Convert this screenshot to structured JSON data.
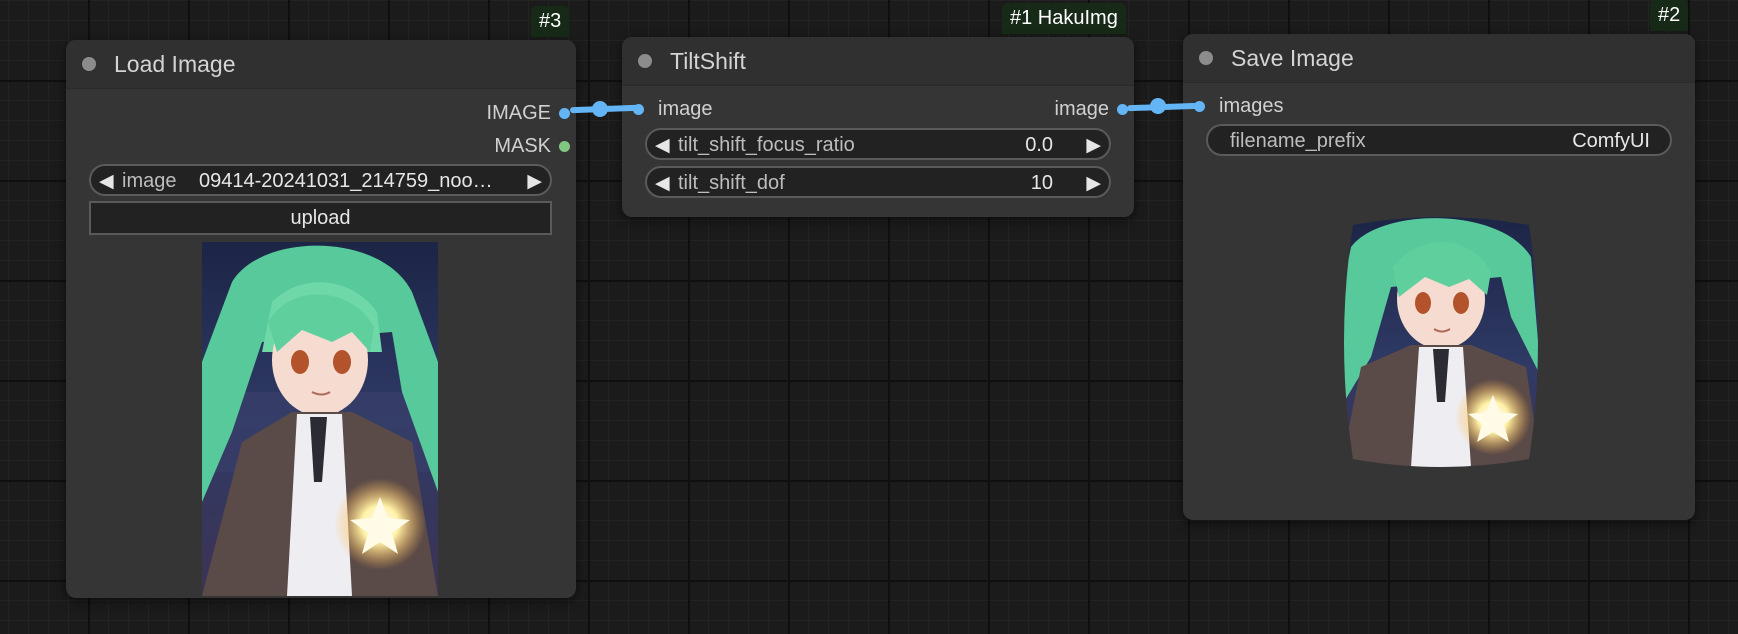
{
  "nodes": {
    "load_image": {
      "title": "Load Image",
      "badge": "#3",
      "outputs": [
        "IMAGE",
        "MASK"
      ],
      "image_widget": {
        "label": "image",
        "value": "09414-20241031_214759_noo…"
      },
      "upload_label": "upload"
    },
    "tilt_shift": {
      "title": "TiltShift",
      "badge": "#1 HakuImg",
      "input": "image",
      "output": "image",
      "widgets": [
        {
          "label": "tilt_shift_focus_ratio",
          "value": "0.0"
        },
        {
          "label": "tilt_shift_dof",
          "value": "10"
        }
      ]
    },
    "save_image": {
      "title": "Save Image",
      "badge": "#2",
      "input": "images",
      "filename_widget": {
        "label": "filename_prefix",
        "value": "ComfyUI"
      }
    }
  },
  "colors": {
    "image_slot": "#64b5f6",
    "mask_slot": "#81c784",
    "node_bg": "#353535",
    "badge_bg": "#172a17"
  },
  "icons": {
    "decrement": "◀",
    "increment": "▶"
  }
}
